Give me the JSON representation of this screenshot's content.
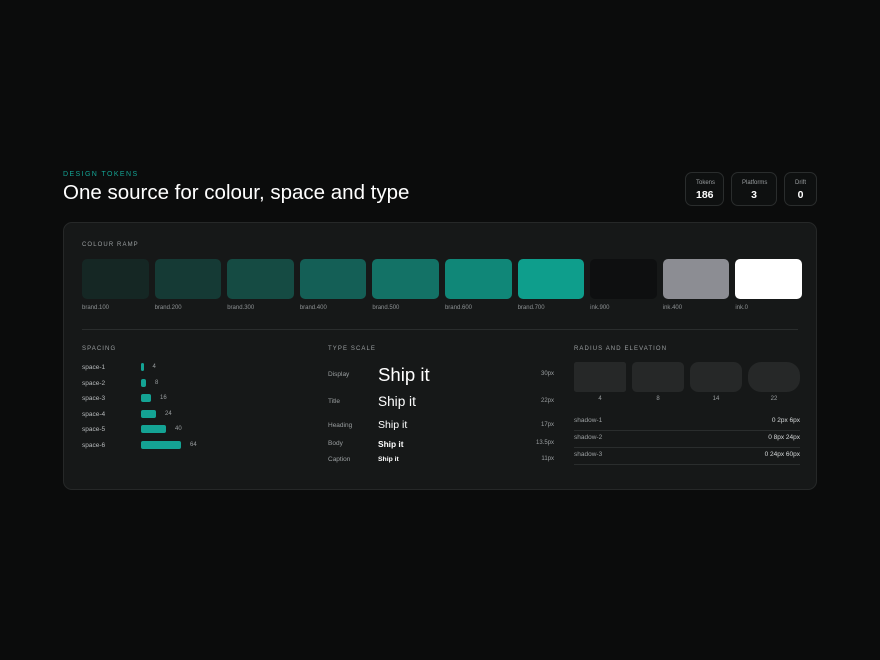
{
  "header": {
    "eyebrow": "DESIGN TOKENS",
    "title": "One source for colour, space and type"
  },
  "stats": [
    {
      "label": "Tokens",
      "value": "186"
    },
    {
      "label": "Platforms",
      "value": "3"
    },
    {
      "label": "Drift",
      "value": "0"
    }
  ],
  "colour_ramp": {
    "label": "COLOUR RAMP",
    "swatches": [
      {
        "name": "brand.100",
        "color": "#152724"
      },
      {
        "name": "brand.200",
        "color": "#153a35"
      },
      {
        "name": "brand.300",
        "color": "#154b43"
      },
      {
        "name": "brand.400",
        "color": "#145f56"
      },
      {
        "name": "brand.500",
        "color": "#137266"
      },
      {
        "name": "brand.600",
        "color": "#108778"
      },
      {
        "name": "brand.700",
        "color": "#0e9e8c"
      },
      {
        "name": "ink.900",
        "color": "#0e0f10"
      },
      {
        "name": "ink.400",
        "color": "#8c8d93"
      },
      {
        "name": "ink.0",
        "color": "#ffffff"
      }
    ]
  },
  "spacing": {
    "label": "SPACING",
    "rows": [
      {
        "name": "space-1",
        "value": "4"
      },
      {
        "name": "space-2",
        "value": "8"
      },
      {
        "name": "space-3",
        "value": "16"
      },
      {
        "name": "space-4",
        "value": "24"
      },
      {
        "name": "space-5",
        "value": "40"
      },
      {
        "name": "space-6",
        "value": "64"
      }
    ]
  },
  "type_scale": {
    "label": "TYPE SCALE",
    "sample": "Ship it",
    "rows": [
      {
        "name": "Display",
        "size": "30px"
      },
      {
        "name": "Title",
        "size": "22px"
      },
      {
        "name": "Heading",
        "size": "17px"
      },
      {
        "name": "Body",
        "size": "13.5px"
      },
      {
        "name": "Caption",
        "size": "11px"
      }
    ]
  },
  "radius_elevation": {
    "label": "RADIUS AND ELEVATION",
    "radii": [
      "4",
      "8",
      "14",
      "22"
    ],
    "shadows": [
      {
        "name": "shadow-1",
        "value": "0 2px 6px"
      },
      {
        "name": "shadow-2",
        "value": "0 8px 24px"
      },
      {
        "name": "shadow-3",
        "value": "0 24px 60px"
      }
    ]
  },
  "accent_color": "#14a394"
}
